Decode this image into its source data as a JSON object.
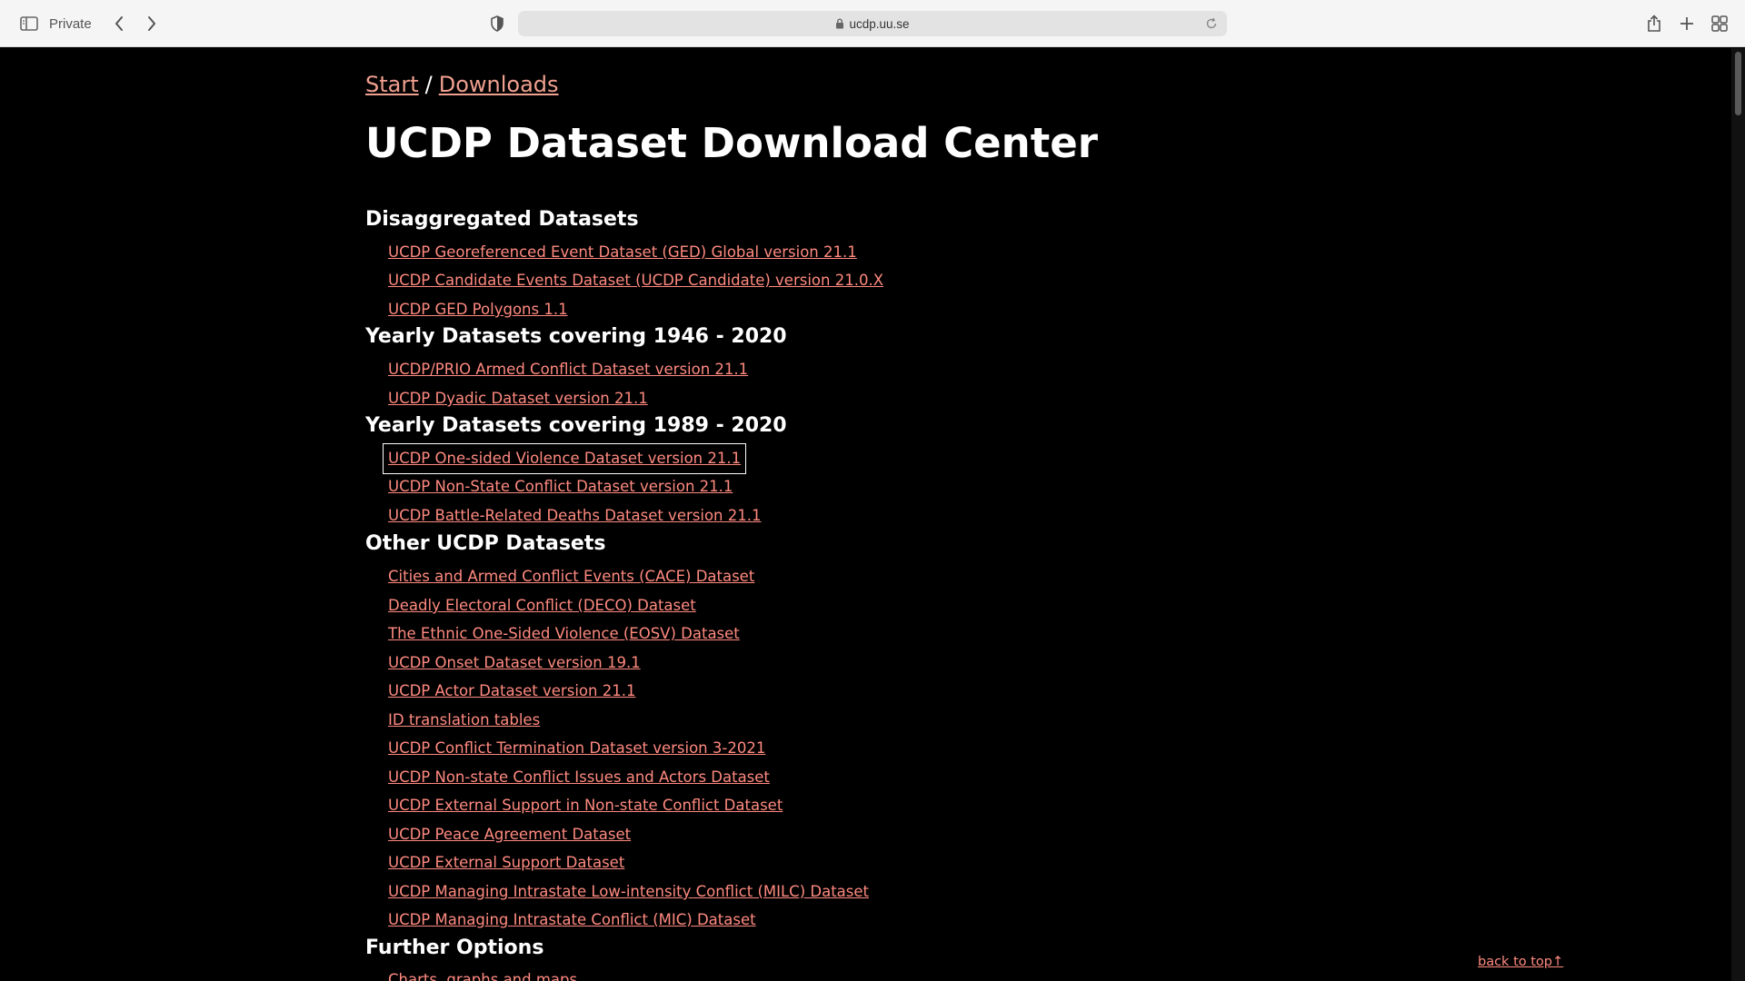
{
  "browser": {
    "private_label": "Private",
    "url": "ucdp.uu.se"
  },
  "breadcrumb": {
    "start": "Start",
    "separator": "/",
    "downloads": "Downloads"
  },
  "page_title": "UCDP Dataset Download Center",
  "sections": [
    {
      "heading": "Disaggregated Datasets",
      "links": [
        "UCDP Georeferenced Event Dataset (GED) Global version 21.1",
        "UCDP Candidate Events Dataset (UCDP Candidate) version 21.0.X",
        "UCDP GED Polygons 1.1"
      ]
    },
    {
      "heading": "Yearly Datasets covering 1946 - 2020",
      "links": [
        "UCDP/PRIO Armed Conflict Dataset version 21.1",
        "UCDP Dyadic Dataset version 21.1"
      ]
    },
    {
      "heading": "Yearly Datasets covering 1989 - 2020",
      "links": [
        "UCDP One-sided Violence Dataset version 21.1",
        "UCDP Non-State Conflict Dataset version 21.1",
        "UCDP Battle-Related Deaths Dataset version 21.1"
      ]
    },
    {
      "heading": "Other UCDP Datasets",
      "links": [
        "Cities and Armed Conflict Events (CACE) Dataset",
        "Deadly Electoral Conflict (DECO) Dataset",
        "The Ethnic One-Sided Violence (EOSV) Dataset",
        "UCDP Onset Dataset version 19.1",
        "UCDP Actor Dataset version 21.1",
        "ID translation tables",
        "UCDP Conflict Termination Dataset version 3-2021",
        "UCDP Non-state Conflict Issues and Actors Dataset",
        "UCDP External Support in Non-state Conflict Dataset",
        "UCDP Peace Agreement Dataset",
        "UCDP External Support Dataset",
        "UCDP Managing Intrastate Low-intensity Conflict (MILC) Dataset",
        "UCDP Managing Intrastate Conflict (MIC) Dataset"
      ]
    },
    {
      "heading": "Further Options",
      "links": [
        "Charts, graphs and maps"
      ]
    }
  ],
  "back_to_top": "back to top↑",
  "colors": {
    "background": "#000000",
    "link": "#ff8a80",
    "breadcrumb_link": "#f0a090",
    "text": "#ffffff",
    "toolbar": "#f5f5f5"
  }
}
